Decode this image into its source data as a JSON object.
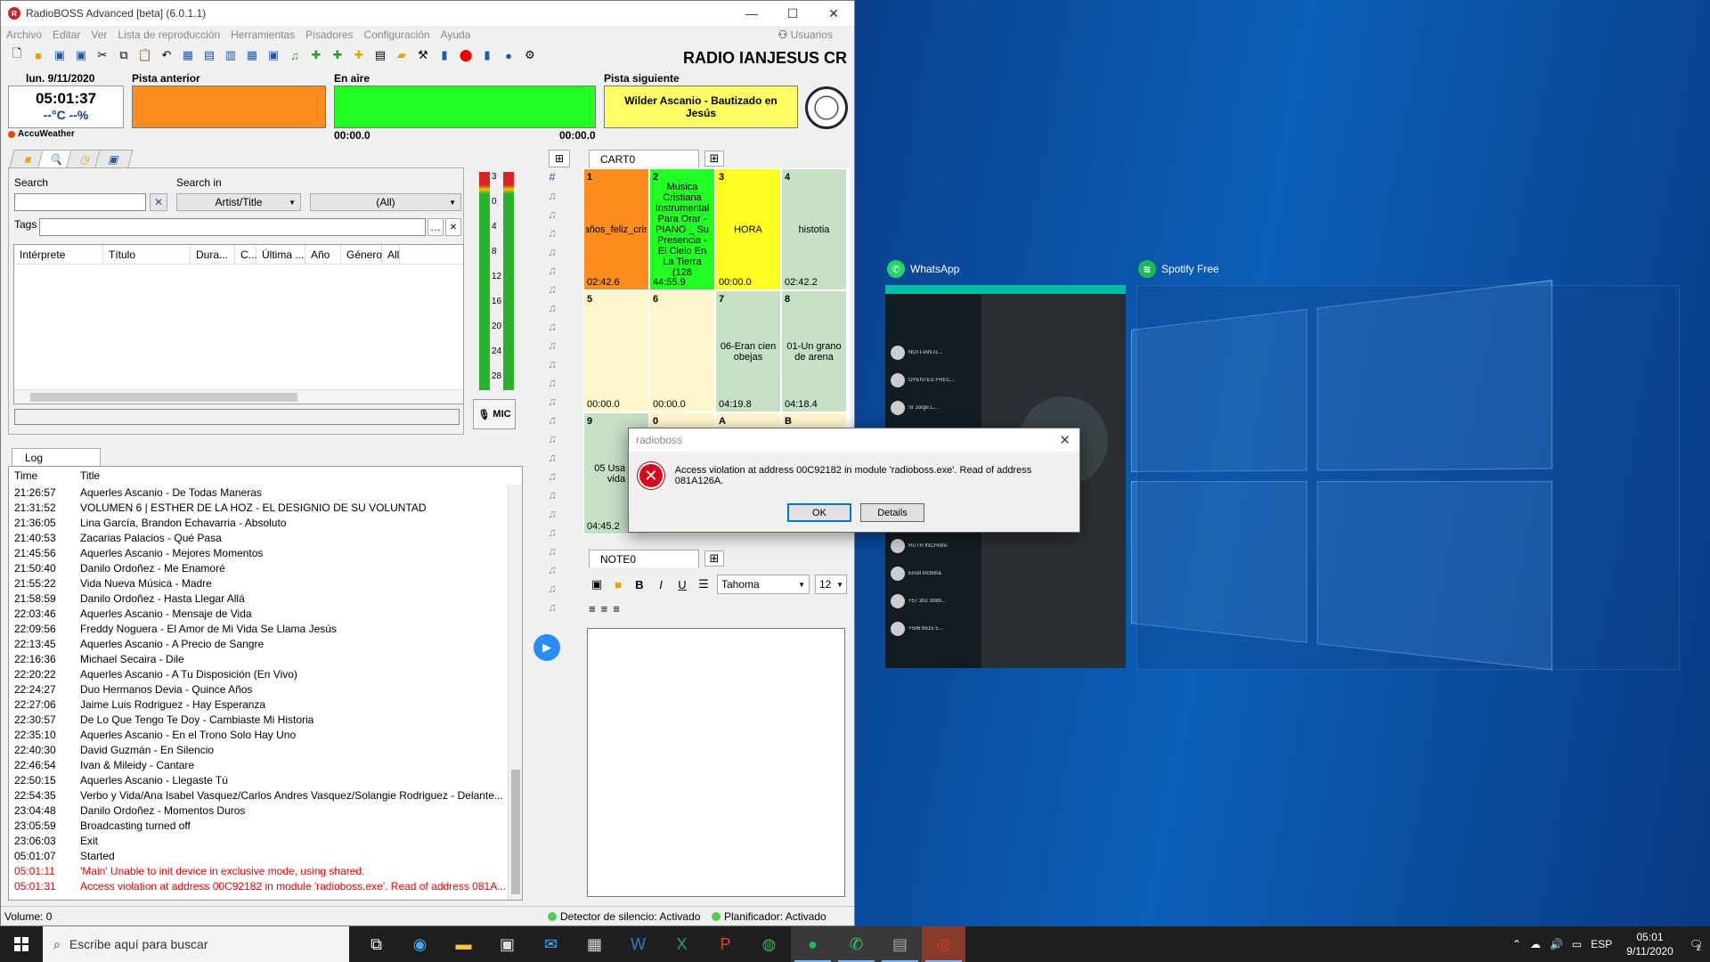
{
  "window": {
    "title": "RadioBOSS Advanced [beta] (6.0.1.1)",
    "station": "RADIO IANJESUS CR",
    "menu": [
      "Archivo",
      "Editar",
      "Ver",
      "Lista de reproducción",
      "Herramientas",
      "Pisadores",
      "Configuración",
      "Ayuda"
    ],
    "users_label": "Usuarios"
  },
  "clock": {
    "date": "lun. 9/11/2020",
    "time": "05:01:37",
    "weather": "--°C --%",
    "accuweather": "AccuWeather"
  },
  "tracks": {
    "prev_label": "Pista anterior",
    "onair_label": "En aire",
    "next_label": "Pista siguiente",
    "next_title": "Wilder Ascanio - Bautizado en Jesús",
    "onair_time": "00:00.0",
    "next_time": "00:00.0",
    "colors": {
      "prev": "#ff8c1f",
      "onair": "#22ff22",
      "next": "#ffff66"
    }
  },
  "library": {
    "search_label": "Search",
    "search_in_label": "Search in",
    "field_combo": "Artist/Title",
    "scope_combo": "(All)",
    "tags_label": "Tags",
    "columns": [
      "Intérprete",
      "Título",
      "Dura...",
      "C...",
      "Última ...",
      "Año",
      "Género",
      "All"
    ]
  },
  "meter": {
    "scale": [
      "3",
      "0",
      "4",
      "8",
      "12",
      "16",
      "20",
      "24",
      "28"
    ]
  },
  "mic_label": "MIC",
  "log": {
    "tab": "Log",
    "col_time": "Time",
    "col_title": "Title",
    "rows": [
      {
        "t": "21:26:57",
        "title": "Aquerles Ascanio - De Todas Maneras",
        "err": false
      },
      {
        "t": "21:31:52",
        "title": "VOLUMEN 6 | ESTHER DE LA HOZ - EL DESIGNIO DE SU VOLUNTAD",
        "err": false
      },
      {
        "t": "21:36:05",
        "title": "Lina García, Brandon Echavarria - Absoluto",
        "err": false
      },
      {
        "t": "21:40:53",
        "title": "Zacarias Palacios - Qué Pasa",
        "err": false
      },
      {
        "t": "21:45:56",
        "title": "Aquerles Ascanio - Mejores Momentos",
        "err": false
      },
      {
        "t": "21:50:40",
        "title": "Danilo Ordoñez - Me Enamoré",
        "err": false
      },
      {
        "t": "21:55:22",
        "title": "Vida Nueva Música - Madre",
        "err": false
      },
      {
        "t": "21:58:59",
        "title": "Danilo Ordoñez - Hasta Llegar Allá",
        "err": false
      },
      {
        "t": "22:03:46",
        "title": "Aquerles Ascanio - Mensaje de Vida",
        "err": false
      },
      {
        "t": "22:09:56",
        "title": "Freddy Noguera - El Amor de Mi Vida Se Llama Jesús",
        "err": false
      },
      {
        "t": "22:13:45",
        "title": "Aquerles Ascanio - A Precio de Sangre",
        "err": false
      },
      {
        "t": "22:16:36",
        "title": "Michael Secaira - Dile",
        "err": false
      },
      {
        "t": "22:20:22",
        "title": "Aquerles Ascanio - A Tu Disposición (En Vivo)",
        "err": false
      },
      {
        "t": "22:24:27",
        "title": "Duo Hermanos Devia - Quince Años",
        "err": false
      },
      {
        "t": "22:27:06",
        "title": "Jaime Luis Rodriguez - Hay Esperanza",
        "err": false
      },
      {
        "t": "22:30:57",
        "title": "De Lo Que Tengo Te Doy - Cambiaste Mi Historia",
        "err": false
      },
      {
        "t": "22:35:10",
        "title": "Aquerles Ascanio - En el Trono Solo Hay Uno",
        "err": false
      },
      {
        "t": "22:40:30",
        "title": "David Guzmán - En Silencio",
        "err": false
      },
      {
        "t": "22:46:54",
        "title": "Ivan & Mileidy - Cantare",
        "err": false
      },
      {
        "t": "22:50:15",
        "title": "Aquerles Ascanio - Llegaste Tú",
        "err": false
      },
      {
        "t": "22:54:35",
        "title": "Verbo y Vida/Ana Isabel Vasquez/Carlos Andres Vasquez/Solangie Rodriguez - Delante...",
        "err": false
      },
      {
        "t": "23:04:48",
        "title": "Danilo Ordoñez - Momentos Duros",
        "err": false
      },
      {
        "t": "23:05:59",
        "title": "Broadcasting turned off",
        "err": false
      },
      {
        "t": "23:06:03",
        "title": "Exit",
        "err": false
      },
      {
        "t": "05:01:07",
        "title": "Started",
        "err": false
      },
      {
        "t": "05:01:11",
        "title": "'Main' Unable to init device in exclusive mode, using shared.",
        "err": true
      },
      {
        "t": "05:01:31",
        "title": "Access violation at address 00C92182 in module 'radioboss.exe'. Read of address 081A...",
        "err": true
      }
    ]
  },
  "status": {
    "volume": "Volume: 0",
    "silence": "Detector de silencio: Activado",
    "scheduler": "Planificador: Activado"
  },
  "cart": {
    "tab": "CART0",
    "cells": [
      {
        "n": "1",
        "c": "años_feliz_cris",
        "d": "02:42.6",
        "color": "#ff8c1f"
      },
      {
        "n": "2",
        "c": "Musica Cristiana Instrumental Para Orar - PIANO _ Su Presencia - El Cielo En La Tierra (128",
        "d": "44:55.9",
        "color": "#22ff22"
      },
      {
        "n": "3",
        "c": "HORA",
        "d": "00:00.0",
        "color": "#ffff22"
      },
      {
        "n": "4",
        "c": "histotia",
        "d": "02:42.2",
        "color": "#c6e0c6"
      },
      {
        "n": "5",
        "c": "",
        "d": "00:00.0",
        "color": "#fff8cc"
      },
      {
        "n": "6",
        "c": "",
        "d": "00:00.0",
        "color": "#fff8cc"
      },
      {
        "n": "7",
        "c": "06-Eran cien obejas",
        "d": "04:19.8",
        "color": "#c6e0c6"
      },
      {
        "n": "8",
        "c": "01-Un grano de arena",
        "d": "04:18.4",
        "color": "#c6e0c6"
      },
      {
        "n": "9",
        "c": "05 Usa mi vida",
        "d": "04:45.2",
        "color": "#c6e0c6"
      },
      {
        "n": "0",
        "c": "",
        "d": "",
        "color": "#fff8cc"
      },
      {
        "n": "A",
        "c": "",
        "d": "",
        "color": "#fff8cc"
      },
      {
        "n": "B",
        "c": "",
        "d": "",
        "color": "#fff8cc"
      }
    ]
  },
  "note": {
    "tab": "NOTE0",
    "font": "Tahoma",
    "size": "12"
  },
  "dialog": {
    "title": "radioboss",
    "message": "Access violation at address 00C92182 in module 'radioboss.exe'. Read of address 081A126A.",
    "ok": "OK",
    "details": "Details"
  },
  "taskview": {
    "whatsapp_label": "WhatsApp",
    "spotify_label": "Spotify Free",
    "wa_chats": [
      "NOTI-IAN.G...",
      "OYENTES FREC...",
      "Sr Jorge L...",
      "HNA LIDI...",
      "",
      "",
      "Pastor Washin...",
      "RUTH INCHIMA",
      "Enod Inchima",
      "+57 302 3089...",
      "+506 8515 5..."
    ],
    "wa_phone": "fono"
  },
  "taskbar": {
    "search_placeholder": "Escribe aquí para buscar",
    "lang": "ESP",
    "time": "05:01",
    "date": "9/11/2020",
    "notif_count": "2"
  }
}
